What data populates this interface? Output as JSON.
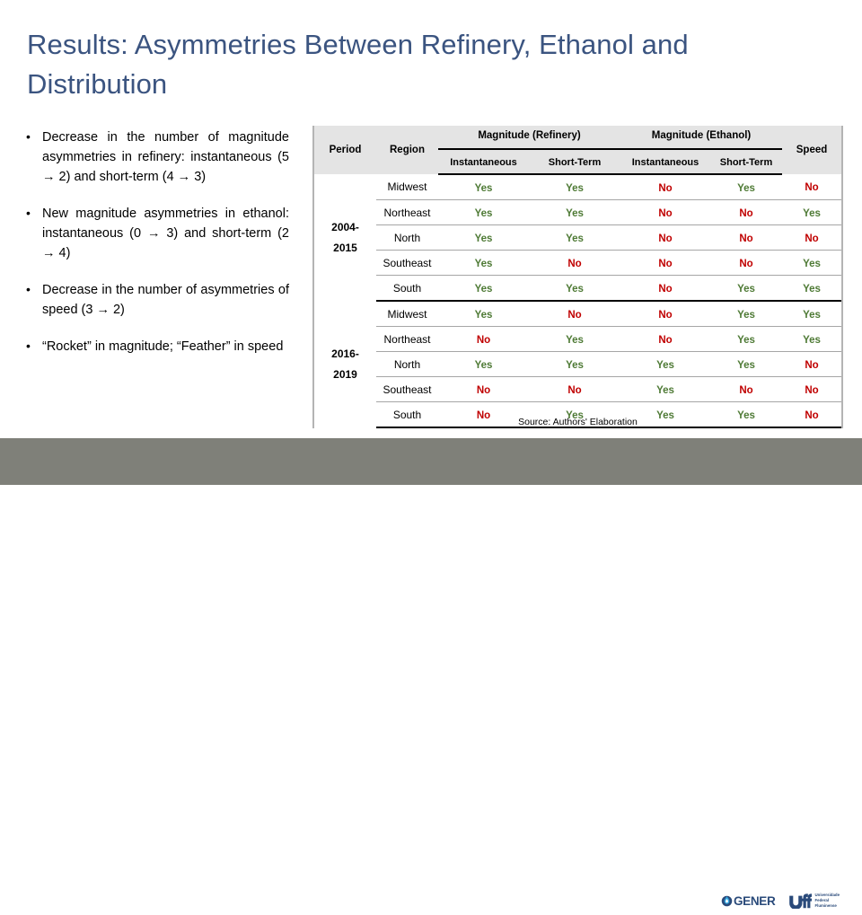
{
  "slide": {
    "title": "Results: Asymmetries Between Refinery, Ethanol and Distribution",
    "title_color": "#3b5480"
  },
  "bullets": [
    {
      "marker": "•",
      "text": "Decrease in the number of magnitude asymmetries in refinery: instantaneous (5 → 2) and short-term (4 → 3)"
    },
    {
      "marker": "•",
      "text": "New magnitude asymmetries in ethanol: instantaneous (0 → 3) and short-term (2 → 4)"
    },
    {
      "marker": "•",
      "text": "Decrease in the number of asymmetries of speed (3 → 2)"
    },
    {
      "marker": "•",
      "text": "“Rocket” in magnitude; “Feather” in speed"
    }
  ],
  "table": {
    "headers": {
      "period": "Period",
      "region": "Region",
      "group_refinery": "Magnitude (Refinery)",
      "group_ethanol": "Magnitude (Ethanol)",
      "speed": "Speed",
      "sub_instantaneous_refinery": "Instantaneous",
      "sub_shortterm_refinery": "Short-Term",
      "sub_instantaneous_ethanol": "Instantaneous",
      "sub_shortterm_ethanol": "Short-Term"
    },
    "blocks": [
      {
        "period_line1": "2004-",
        "period_line2": "2015",
        "rows": [
          {
            "region": "Midwest",
            "ref_inst": "Yes",
            "ref_short": "Yes",
            "eth_inst": "No",
            "eth_short": "Yes",
            "speed": "No"
          },
          {
            "region": "Northeast",
            "ref_inst": "Yes",
            "ref_short": "Yes",
            "eth_inst": "No",
            "eth_short": "No",
            "speed": "Yes"
          },
          {
            "region": "North",
            "ref_inst": "Yes",
            "ref_short": "Yes",
            "eth_inst": "No",
            "eth_short": "No",
            "speed": "No"
          },
          {
            "region": "Southeast",
            "ref_inst": "Yes",
            "ref_short": "No",
            "eth_inst": "No",
            "eth_short": "No",
            "speed": "Yes"
          },
          {
            "region": "South",
            "ref_inst": "Yes",
            "ref_short": "Yes",
            "eth_inst": "No",
            "eth_short": "Yes",
            "speed": "Yes"
          }
        ]
      },
      {
        "period_line1": "2016-",
        "period_line2": "2019",
        "rows": [
          {
            "region": "Midwest",
            "ref_inst": "Yes",
            "ref_short": "No",
            "eth_inst": "No",
            "eth_short": "Yes",
            "speed": "Yes"
          },
          {
            "region": "Northeast",
            "ref_inst": "No",
            "ref_short": "Yes",
            "eth_inst": "No",
            "eth_short": "Yes",
            "speed": "Yes"
          },
          {
            "region": "North",
            "ref_inst": "Yes",
            "ref_short": "Yes",
            "eth_inst": "Yes",
            "eth_short": "Yes",
            "speed": "No"
          },
          {
            "region": "Southeast",
            "ref_inst": "No",
            "ref_short": "No",
            "eth_inst": "Yes",
            "eth_short": "No",
            "speed": "No"
          },
          {
            "region": "South",
            "ref_inst": "No",
            "ref_short": "Yes",
            "eth_inst": "Yes",
            "eth_short": "Yes",
            "speed": "No"
          }
        ]
      }
    ],
    "value_colors": {
      "Yes": "#4e7a35",
      "No": "#c00000"
    }
  },
  "source_note": "Source: Authors' Elaboration",
  "footer": {
    "bar_color": "#7f8079",
    "logos": {
      "gener_text": "GENER",
      "uff_mark_text": "uff",
      "uff_line1": "Universidade",
      "uff_line2": "Federal",
      "uff_line3": "Fluminense"
    }
  }
}
